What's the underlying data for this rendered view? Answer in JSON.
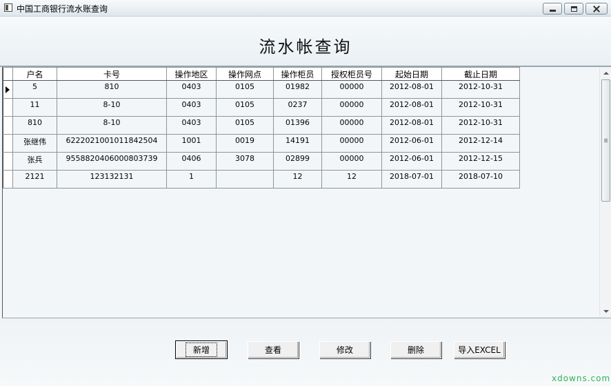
{
  "window": {
    "title": "中国工商银行流水账查询"
  },
  "header": {
    "title": "流水帐查询"
  },
  "grid": {
    "columns": [
      "户名",
      "卡号",
      "操作地区",
      "操作网点",
      "操作柜员",
      "授权柜员号",
      "起始日期",
      "截止日期"
    ],
    "rows": [
      [
        "5",
        "810",
        "0403",
        "0105",
        "01982",
        "00000",
        "2012-08-01",
        "2012-10-31"
      ],
      [
        "11",
        "8-10",
        "0403",
        "0105",
        "0237",
        "00000",
        "2012-08-01",
        "2012-10-31"
      ],
      [
        "810",
        "8-10",
        "0403",
        "0105",
        "01396",
        "00000",
        "2012-08-01",
        "2012-10-31"
      ],
      [
        "张继伟",
        "6222021001011842504",
        "1001",
        "0019",
        "14191",
        "00000",
        "2012-06-01",
        "2012-12-14"
      ],
      [
        "张兵",
        "9558820406000803739",
        "0406",
        "3078",
        "02899",
        "00000",
        "2012-06-01",
        "2012-12-15"
      ],
      [
        "2121",
        "123132131",
        "1",
        "",
        "12",
        "12",
        "2018-07-01",
        "2018-07-10"
      ]
    ]
  },
  "buttons": {
    "add": "新增",
    "view": "查看",
    "edit": "修改",
    "delete": "删除",
    "import_excel": "导入EXCEL"
  },
  "watermark": "xdowns.com"
}
